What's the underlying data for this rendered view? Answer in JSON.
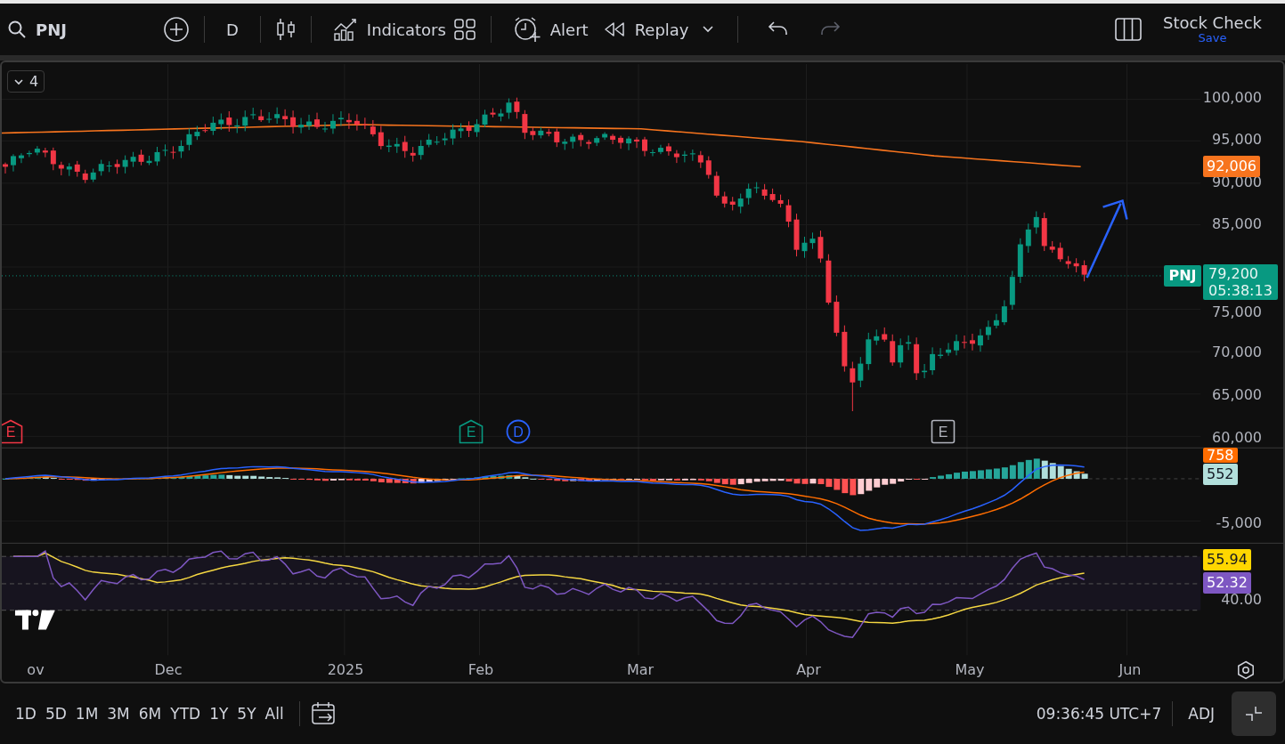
{
  "toolbar": {
    "symbol": "PNJ",
    "interval": "D",
    "indicators_label": "Indicators",
    "alert_label": "Alert",
    "replay_label": "Replay",
    "undo": {
      "disabled": false
    },
    "redo": {
      "disabled": true
    },
    "layout_name": "Stock Check",
    "save_label": "Save"
  },
  "chart": {
    "collapse_count": "4",
    "price_axis": [
      "100,000",
      "95,000",
      "90,000",
      "85,000",
      "75,000",
      "70,000",
      "65,000",
      "60,000"
    ],
    "ma_tag": "92,006",
    "symbol_tag": "PNJ",
    "last_price": "79,200",
    "countdown": "05:38:13",
    "events": [
      {
        "kind": "earnings",
        "label": "E",
        "color": "#f23645"
      },
      {
        "kind": "earnings",
        "label": "E",
        "color": "#089981"
      },
      {
        "kind": "dividend",
        "label": "D",
        "color": "#2962ff"
      },
      {
        "kind": "earnings",
        "label": "E",
        "color": "#b2b5be"
      }
    ],
    "macd": {
      "signal_tag": "758",
      "hist_tag": "552",
      "axis": [
        "-5,000"
      ]
    },
    "rsi": {
      "ma_tag": "55.94",
      "rsi_tag": "52.32",
      "axis": [
        "40.00"
      ]
    },
    "date_axis": [
      "ov",
      "Dec",
      "2025",
      "Feb",
      "Mar",
      "Apr",
      "May",
      "Jun"
    ]
  },
  "bottom_bar": {
    "ranges": [
      "1D",
      "5D",
      "1M",
      "3M",
      "6M",
      "YTD",
      "1Y",
      "5Y",
      "All"
    ],
    "clock": "09:36:45 UTC+7",
    "adj_label": "ADJ"
  }
}
